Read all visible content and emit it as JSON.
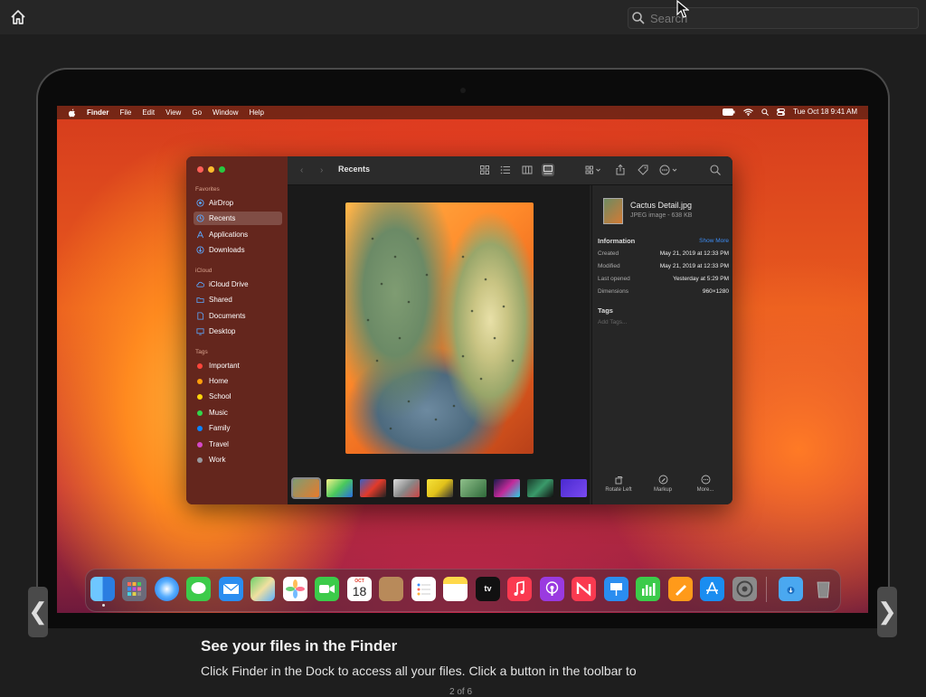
{
  "topbar": {
    "home_icon": "home-icon",
    "search": {
      "placeholder": "Search",
      "icon": "search-icon"
    }
  },
  "menubar": {
    "items": [
      "Finder",
      "File",
      "Edit",
      "View",
      "Go",
      "Window",
      "Help"
    ],
    "clock": "Tue Oct 18  9:41 AM"
  },
  "finder": {
    "title": "Recents",
    "sidebar": {
      "sections": {
        "favorites": "Favorites",
        "icloud": "iCloud",
        "tags": "Tags"
      },
      "favorites": [
        "AirDrop",
        "Recents",
        "Applications",
        "Downloads"
      ],
      "icloud": [
        "iCloud Drive",
        "Shared",
        "Documents",
        "Desktop"
      ],
      "tags": [
        {
          "label": "Important",
          "color": "#ff453a"
        },
        {
          "label": "Home",
          "color": "#ff9f0a"
        },
        {
          "label": "School",
          "color": "#ffd60a"
        },
        {
          "label": "Music",
          "color": "#32d74b"
        },
        {
          "label": "Family",
          "color": "#0a84ff"
        },
        {
          "label": "Travel",
          "color": "#d648c8"
        },
        {
          "label": "Work",
          "color": "#98989d"
        }
      ]
    },
    "info": {
      "file_name": "Cactus Detail.jpg",
      "file_kind": "JPEG image - 638 KB",
      "information_label": "Information",
      "show_more": "Show More",
      "rows": [
        {
          "label": "Created",
          "value": "May 21, 2019 at 12:33 PM"
        },
        {
          "label": "Modified",
          "value": "May 21, 2019 at 12:33 PM"
        },
        {
          "label": "Last opened",
          "value": "Yesterday at 5:29 PM"
        },
        {
          "label": "Dimensions",
          "value": "960×1280"
        }
      ],
      "tags_label": "Tags",
      "add_tags": "Add Tags...",
      "actions": [
        "Rotate Left",
        "Markup",
        "More..."
      ]
    }
  },
  "dock": {
    "calendar_month": "OCT",
    "calendar_day": "18",
    "tv_label": "tv"
  },
  "caption": {
    "title": "See your files in the Finder",
    "body": "Click Finder  in the Dock to access all your files. Click a button in the toolbar to",
    "pager": "2 of 6"
  },
  "nav": {
    "prev": "❮",
    "next": "❯"
  }
}
